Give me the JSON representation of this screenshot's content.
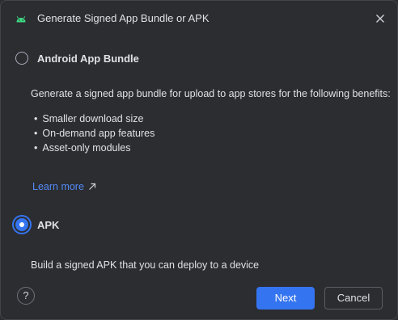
{
  "dialog": {
    "title": "Generate Signed App Bundle or APK",
    "icon": "android-icon",
    "close_icon": "close-icon"
  },
  "options": {
    "bundle": {
      "label": "Android App Bundle",
      "selected": false,
      "description": "Generate a signed app bundle for upload to app stores for the following benefits:",
      "benefits": [
        "Smaller download size",
        "On-demand app features",
        "Asset-only modules"
      ],
      "learn_more": "Learn more",
      "learn_more_icon": "external-link-icon"
    },
    "apk": {
      "label": "APK",
      "selected": true,
      "description": "Build a signed APK that you can deploy to a device"
    }
  },
  "footer": {
    "help_label": "?",
    "next_label": "Next",
    "cancel_label": "Cancel"
  },
  "colors": {
    "background": "#2b2d30",
    "accent": "#3574f0",
    "link": "#548af7",
    "android_green": "#3ddc84"
  }
}
